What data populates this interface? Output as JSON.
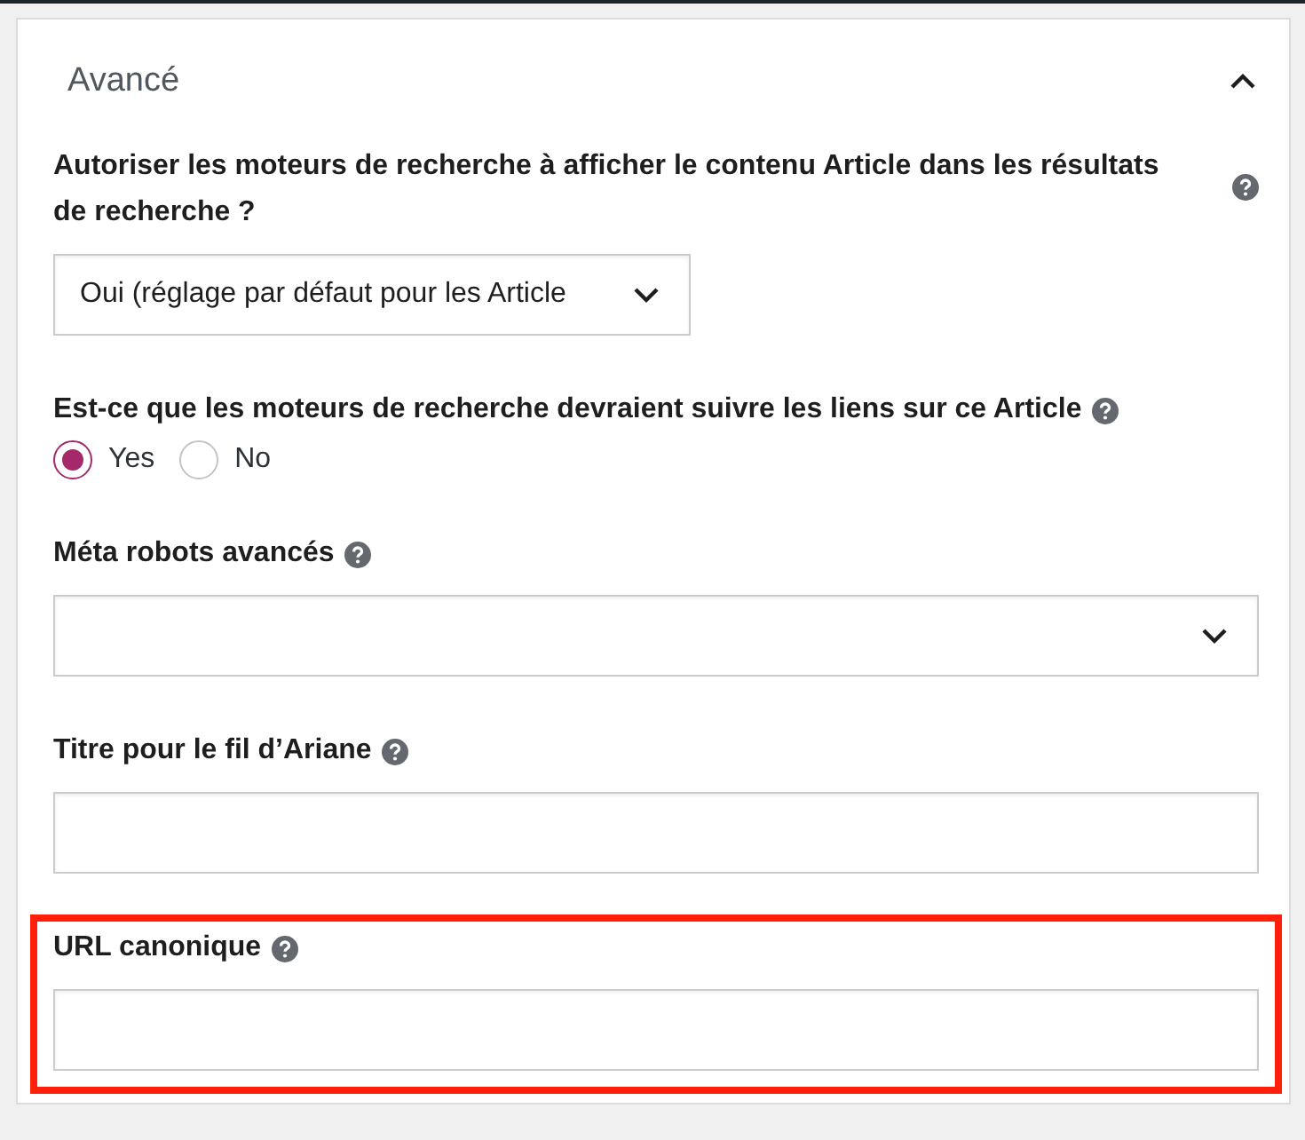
{
  "section": {
    "title": "Avancé",
    "expanded": true
  },
  "fields": [
    {
      "kind": "select",
      "label": "Autoriser les moteurs de recherche à afficher le contenu Article dans les résultats de recherche ?",
      "value": "Oui (réglage par défaut pour les Article",
      "wide": false
    },
    {
      "kind": "radio",
      "label": "Est-ce que les moteurs de recherche devraient suivre les liens sur ce Article",
      "options": [
        {
          "label": "Yes",
          "selected": true
        },
        {
          "label": "No",
          "selected": false
        }
      ]
    },
    {
      "kind": "select",
      "label": "Méta robots avancés",
      "wide": true
    },
    {
      "kind": "text",
      "label": "Titre pour le fil d’Ariane"
    },
    {
      "kind": "text",
      "label": "URL canonique",
      "highlighted": true
    }
  ]
}
